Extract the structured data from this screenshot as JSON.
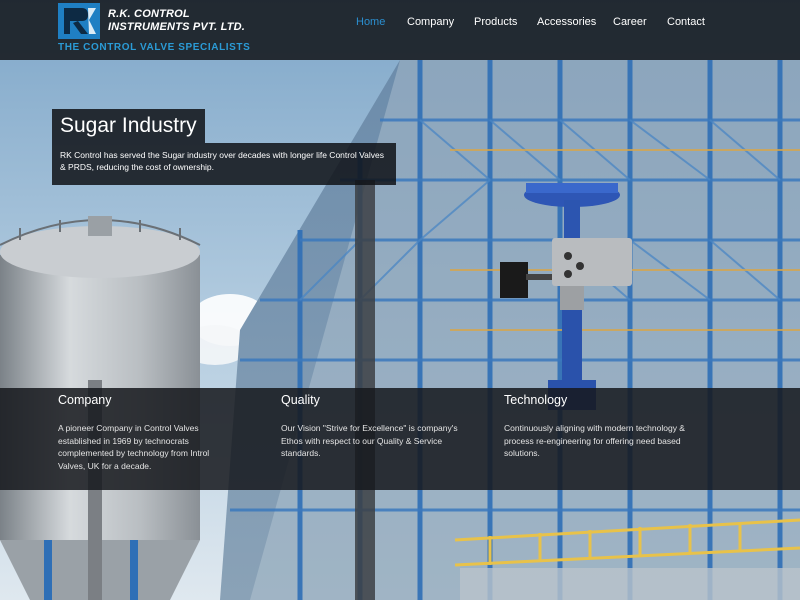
{
  "header": {
    "logo_name": "R.K. CONTROL INSTRUMENTS PVT. LTD.",
    "logo_tagline": "THE CONTROL VALVE SPECIALISTS",
    "nav": [
      {
        "label": "Home",
        "active": true
      },
      {
        "label": "Company",
        "active": false
      },
      {
        "label": "Products",
        "active": false
      },
      {
        "label": "Accessories",
        "active": false
      },
      {
        "label": "Career",
        "active": false
      },
      {
        "label": "Contact",
        "active": false
      }
    ]
  },
  "hero": {
    "title": "Sugar Industry",
    "text": "RK Control has served the Sugar industry over decades with longer life Control Valves & PRDS, reducing the cost of ownership."
  },
  "info": [
    {
      "title": "Company",
      "body": "A pioneer Company in Control Valves established in 1969 by technocrats complemented by technology from Introl Valves, UK for a decade."
    },
    {
      "title": "Quality",
      "body": "Our Vision \"Strive for Excellence\" is company's Ethos with respect to our Quality & Service standards."
    },
    {
      "title": "Technology",
      "body": "Continuously aligning with modern technology & process re-engineering for offering need based solutions."
    }
  ],
  "colors": {
    "accent": "#2b8fd0",
    "tagline": "#2b9bd6",
    "header_bg": "#14181c",
    "structure": "#2f6fb6"
  },
  "icons": {
    "logo": "rk-logo-icon"
  }
}
